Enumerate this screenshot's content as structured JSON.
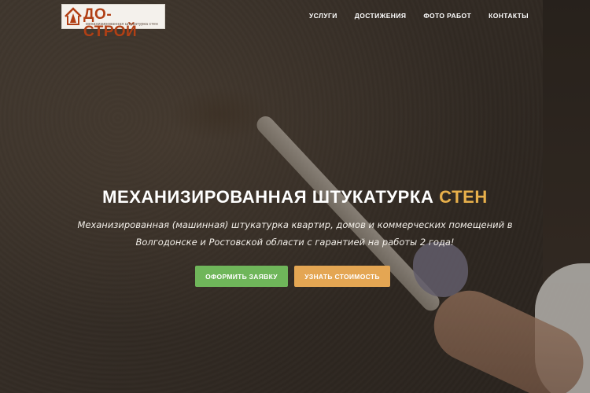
{
  "header": {
    "logo_text": "ДО-СТРОЙ",
    "logo_subtitle": "механизированная штукатурка стен",
    "nav": [
      {
        "label": "УСЛУГИ"
      },
      {
        "label": "ДОСТИЖЕНИЯ"
      },
      {
        "label": "ФОТО РАБОТ"
      },
      {
        "label": "КОНТАКТЫ"
      }
    ]
  },
  "hero": {
    "title_main": "МЕХАНИЗИРОВАННАЯ ШТУКАТУРКА",
    "title_accent": "СТЕН",
    "subtitle": "Механизированная (машинная) штукатурка квартир, домов и коммерческих помещений в Волгодонске и Ростовской области с гарантией на работы 2 года!",
    "buttons": {
      "order_label": "ОФОРМИТЬ ЗАЯВКУ",
      "price_label": "УЗНАТЬ СТОИМОСТЬ"
    }
  },
  "colors": {
    "accent_gold": "#e8b04b",
    "button_green": "#6fb65a",
    "button_orange": "#e4a653",
    "logo_red": "#b13f14"
  },
  "icons": {
    "logo_icon": "house-icon"
  }
}
